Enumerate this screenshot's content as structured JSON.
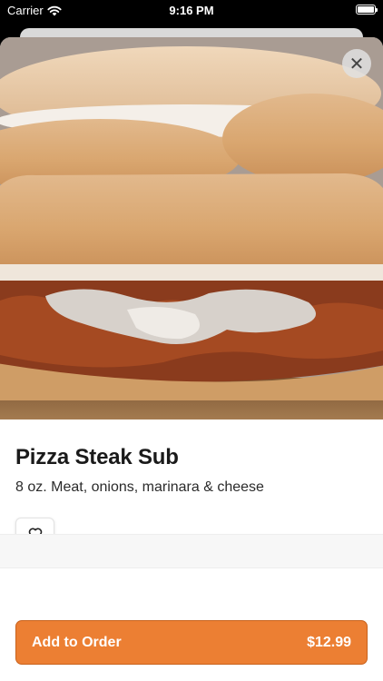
{
  "status_bar": {
    "carrier": "Carrier",
    "time": "9:16 PM"
  },
  "item": {
    "name": "Pizza Steak Sub",
    "description": "8 oz. Meat, onions, marinara & cheese",
    "image_alt": "Pizza Steak Sub sandwich"
  },
  "actions": {
    "close_icon": "close-icon",
    "favorite_icon": "heart-outline-icon",
    "add_to_order_label": "Add to Order",
    "price": "$12.99"
  },
  "colors": {
    "accent": "#ec7f33",
    "text": "#1a1a1a"
  }
}
